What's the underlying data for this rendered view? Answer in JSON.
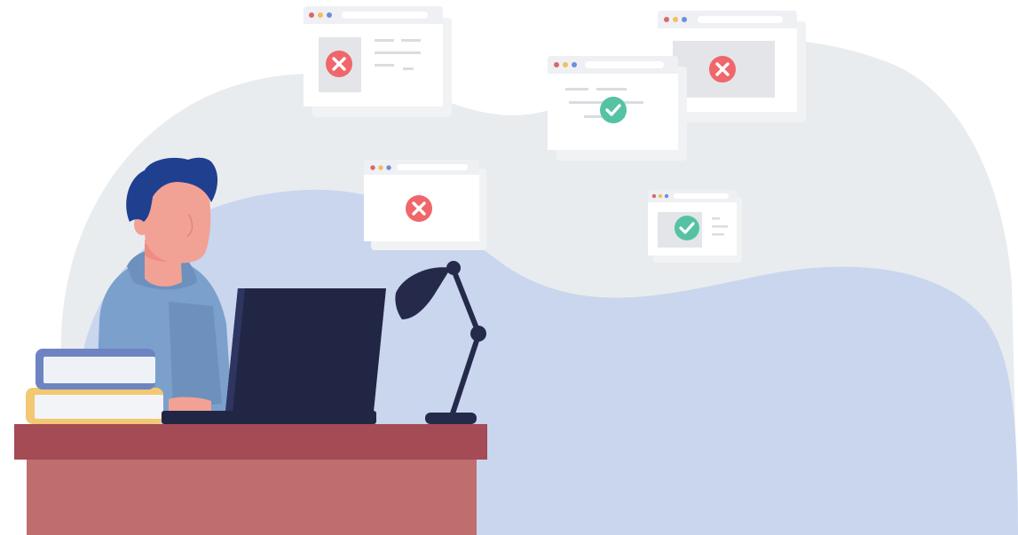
{
  "colors": {
    "background": "#ffffff",
    "blob_back": "#e9ecef",
    "blob_front": "#c9d6ee",
    "window_frame": "#eef0f3",
    "window_shadow": "#f1f2f4",
    "window_body": "#ffffff",
    "window_pane": "#e3e5e8",
    "window_lines": "#d9dde2",
    "dot_red": "#d8696b",
    "dot_yellow": "#f1c05a",
    "dot_blue": "#6f8ed6",
    "error_badge": "#f0666a",
    "success_badge": "#55c2a4",
    "hair": "#1f3f8f",
    "skin": "#f2a195",
    "skin_shadow": "#ee8c82",
    "hoodie": "#7ba0cc",
    "hoodie_dark": "#6d90bd",
    "laptop": "#222645",
    "laptop_edge": "#2f3561",
    "lamp": "#252a4b",
    "lamp_glow": "#f4c66a",
    "desk_top": "#a44b55",
    "desk_body": "#c06d6e",
    "book_top_cover": "#6e84c2",
    "book_top_pages": "#eef1f6",
    "book_bottom_cover": "#f2c872",
    "book_bottom_pages": "#f3f4f7"
  },
  "windows": [
    {
      "status": "error",
      "icon": "close-icon"
    },
    {
      "status": "error",
      "icon": "close-icon"
    },
    {
      "status": "success",
      "icon": "check-icon"
    },
    {
      "status": "error",
      "icon": "close-icon"
    },
    {
      "status": "success",
      "icon": "check-icon"
    }
  ]
}
